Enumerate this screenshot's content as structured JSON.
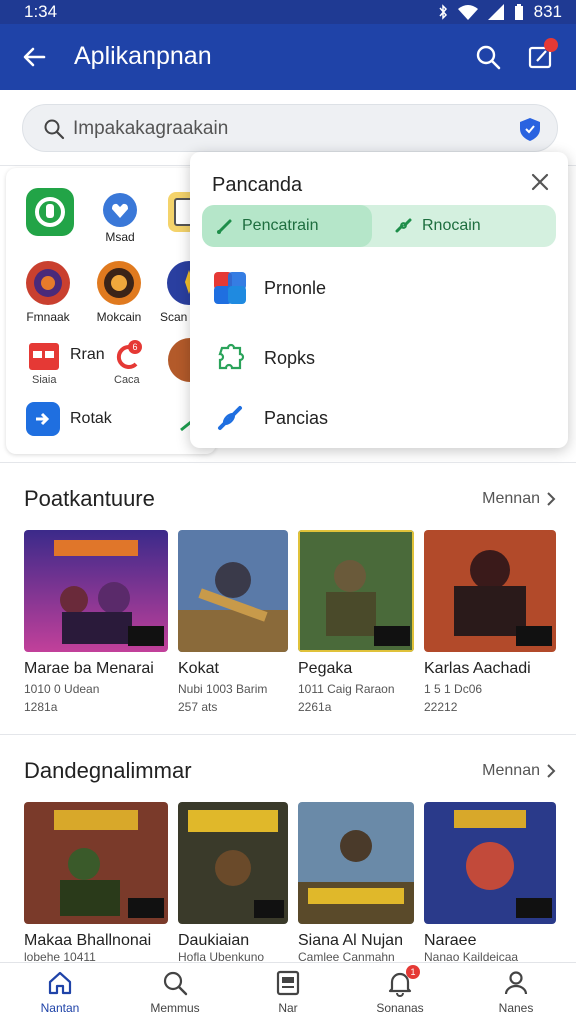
{
  "status_bar": {
    "time": "1:34",
    "right_text": "831"
  },
  "app_bar": {
    "title": "Aplikanpnan",
    "notif_badge": ""
  },
  "search": {
    "placeholder": "Impakakagraakain"
  },
  "app_grid": [
    {
      "label": "",
      "color": "#22a447"
    },
    {
      "label": "Msad",
      "color": "#3a78d8"
    },
    {
      "label": "Fmnaak",
      "color": "#c9402f"
    },
    {
      "label": "Mokcain",
      "color": "#e07a1f"
    },
    {
      "label": "Scan",
      "color": "#2a3fa0"
    },
    {
      "label": "Rran",
      "sub": "Siaia",
      "color": "#e53935"
    },
    {
      "label": "",
      "sub": "Caca",
      "color": "#e53935"
    },
    {
      "label": "Rotak",
      "color": "#1f6fe0"
    }
  ],
  "popup": {
    "title": "Pancanda",
    "seg_a": "Pencatrain",
    "seg_b": "Rnocain",
    "rows": [
      {
        "label": "Prnonle",
        "icon": "apps-icon"
      },
      {
        "label": "Ropks",
        "icon": "puzzle-icon"
      },
      {
        "label": "Pancias",
        "icon": "link-icon"
      }
    ]
  },
  "sections": [
    {
      "title": "Poatkantuure",
      "more": "Mennan",
      "games": [
        {
          "title": "Marae ba Menarai",
          "line1": "1010 0 Udean",
          "line2": "1281a"
        },
        {
          "title": "Kokat",
          "line1": "Nubi 1003 Barim",
          "line2": "257 ats"
        },
        {
          "title": "Pegaka",
          "line1": "1011 Caig Raraon",
          "line2": "2261a"
        },
        {
          "title": "Karlas Aachadi",
          "line1": "1 5 1 Dc06",
          "line2": "22212"
        }
      ]
    },
    {
      "title": "Dandegnalimmar",
      "more": "Mennan",
      "games": [
        {
          "title": "Makaa Bhallnonai",
          "line1": "lobehe 10411"
        },
        {
          "title": "Daukiaian",
          "line1": "Hofla Ubenkuno"
        },
        {
          "title": "Siana Al Nujan",
          "line1": "Camlee Canmahn"
        },
        {
          "title": "Naraee",
          "line1": "Nanao Kaildeicaa"
        }
      ]
    }
  ],
  "bottom_nav": [
    {
      "label": "Nantan",
      "icon": "home-icon",
      "active": true
    },
    {
      "label": "Memmus",
      "icon": "search-icon",
      "active": false
    },
    {
      "label": "Nar",
      "icon": "document-icon",
      "active": false
    },
    {
      "label": "Sonanas",
      "icon": "bell-icon",
      "badge": "1",
      "active": false
    },
    {
      "label": "Nanes",
      "icon": "person-icon",
      "active": false
    }
  ],
  "colors": {
    "primary": "#1f43a8",
    "accent_green": "#1e6e3f"
  }
}
